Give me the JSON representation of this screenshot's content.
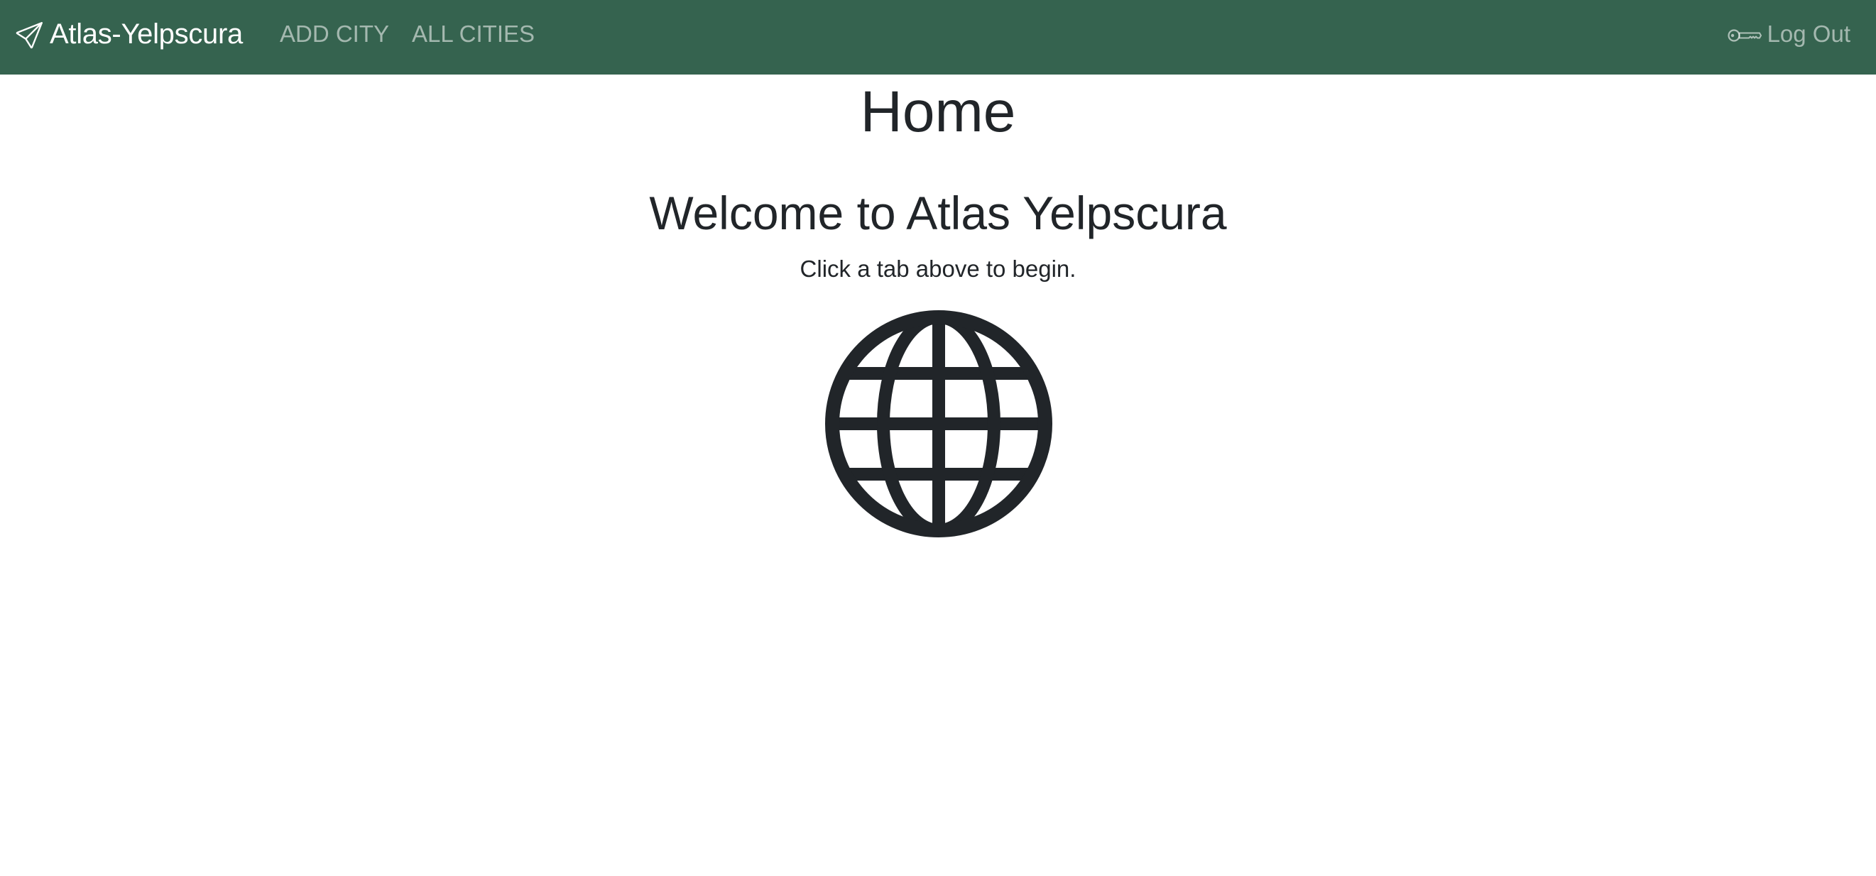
{
  "navbar": {
    "brand": "Atlas-Yelpscura",
    "brand_icon": "send-icon",
    "links": [
      {
        "label": "ADD CITY"
      },
      {
        "label": "ALL CITIES"
      }
    ],
    "logout": {
      "label": "Log Out",
      "icon": "key-icon"
    },
    "background_color": "#35634f"
  },
  "main": {
    "title": "Home",
    "welcome": "Welcome to Atlas Yelpscura",
    "subtitle": "Click a tab above to begin.",
    "illustration_icon": "globe-icon"
  }
}
